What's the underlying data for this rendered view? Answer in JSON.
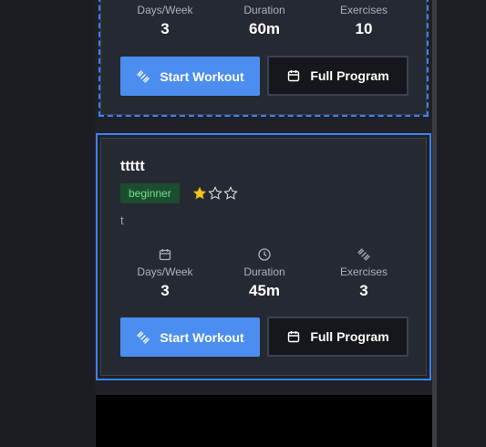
{
  "programs": [
    {
      "stats": [
        {
          "label": "Days/Week",
          "value": "3",
          "icon": "calendar-icon"
        },
        {
          "label": "Duration",
          "value": "60m",
          "icon": "clock-icon"
        },
        {
          "label": "Exercises",
          "value": "10",
          "icon": "dumbbell-icon"
        }
      ],
      "start_label": "Start Workout",
      "full_label": "Full Program"
    },
    {
      "title": "ttttt",
      "level": "beginner",
      "rating": 1,
      "rating_max": 3,
      "description": "t",
      "stats": [
        {
          "label": "Days/Week",
          "value": "3",
          "icon": "calendar-icon"
        },
        {
          "label": "Duration",
          "value": "45m",
          "icon": "clock-icon"
        },
        {
          "label": "Exercises",
          "value": "3",
          "icon": "dumbbell-icon"
        }
      ],
      "start_label": "Start Workout",
      "full_label": "Full Program"
    }
  ],
  "colors": {
    "accent": "#4b8ef0",
    "selection": "#3b82f6",
    "badge_bg": "#1c4d2c",
    "badge_text": "#6fe39a",
    "star": "#f5c518"
  }
}
